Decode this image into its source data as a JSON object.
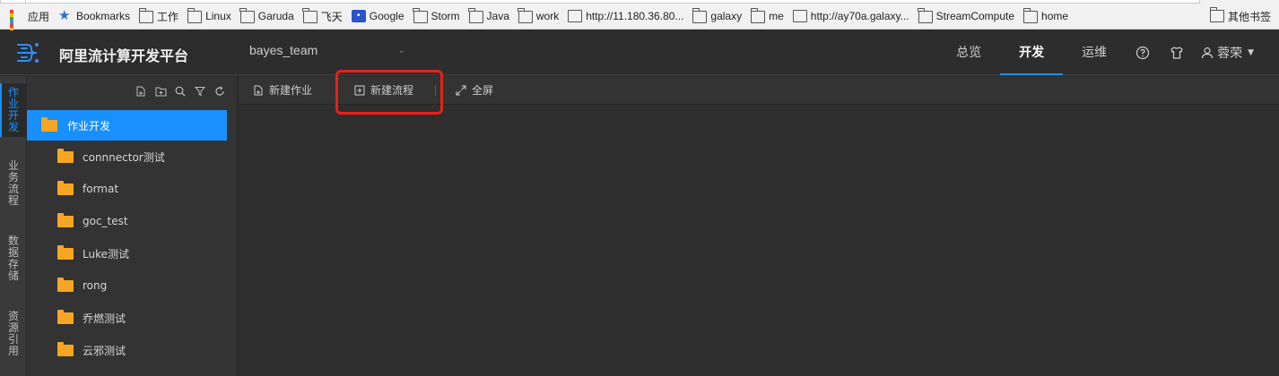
{
  "bookmarks": {
    "items": [
      {
        "label": "应用",
        "icon": "apps-grid-icon",
        "name": "bookmark-apps"
      },
      {
        "label": "Bookmarks",
        "icon": "star-icon",
        "name": "bookmark-bookmarks"
      },
      {
        "label": "工作",
        "icon": "folder-icon",
        "name": "bookmark-work-cn"
      },
      {
        "label": "Linux",
        "icon": "folder-icon",
        "name": "bookmark-linux"
      },
      {
        "label": "Garuda",
        "icon": "folder-icon",
        "name": "bookmark-garuda"
      },
      {
        "label": "飞天",
        "icon": "folder-icon",
        "name": "bookmark-feitian"
      },
      {
        "label": "Google",
        "icon": "paw-icon",
        "name": "bookmark-google"
      },
      {
        "label": "Storm",
        "icon": "folder-icon",
        "name": "bookmark-storm"
      },
      {
        "label": "Java",
        "icon": "folder-icon",
        "name": "bookmark-java"
      },
      {
        "label": "work",
        "icon": "folder-icon",
        "name": "bookmark-work"
      },
      {
        "label": "http://11.180.36.80...",
        "icon": "page-icon",
        "name": "bookmark-http-11"
      },
      {
        "label": "galaxy",
        "icon": "folder-icon",
        "name": "bookmark-galaxy"
      },
      {
        "label": "me",
        "icon": "folder-icon",
        "name": "bookmark-me"
      },
      {
        "label": "http://ay70a.galaxy...",
        "icon": "page-icon",
        "name": "bookmark-http-ay70a"
      },
      {
        "label": "StreamCompute",
        "icon": "folder-icon",
        "name": "bookmark-streamcompute"
      },
      {
        "label": "home",
        "icon": "folder-icon",
        "name": "bookmark-home"
      }
    ],
    "other": "其他书签"
  },
  "header": {
    "title": "阿里流计算开发平台",
    "team": "bayes_team",
    "tabs": [
      "总览",
      "开发",
      "运维"
    ],
    "active_tab": 1,
    "user": "蓉荣",
    "accent": "#1890ff"
  },
  "side_tabs": [
    {
      "label": "作业开发",
      "active": true
    },
    {
      "label": "业务流程",
      "active": false
    },
    {
      "label": "数据存储",
      "active": false
    },
    {
      "label": "资源引用",
      "active": false
    }
  ],
  "tree": {
    "tools": [
      "new-file-icon",
      "new-folder-icon",
      "search-icon",
      "filter-icon",
      "refresh-icon"
    ],
    "root": "作业开发",
    "items": [
      "connnector测试",
      "format",
      "goc_test",
      "Luke测试",
      "rong",
      "乔燃测试",
      "云邪测试"
    ]
  },
  "toolbar": {
    "new_job": "新建作业",
    "new_flow": "新建流程",
    "fullscreen": "全屏"
  },
  "colors": {
    "highlight": "#e8201a",
    "folder": "#f6a623"
  }
}
